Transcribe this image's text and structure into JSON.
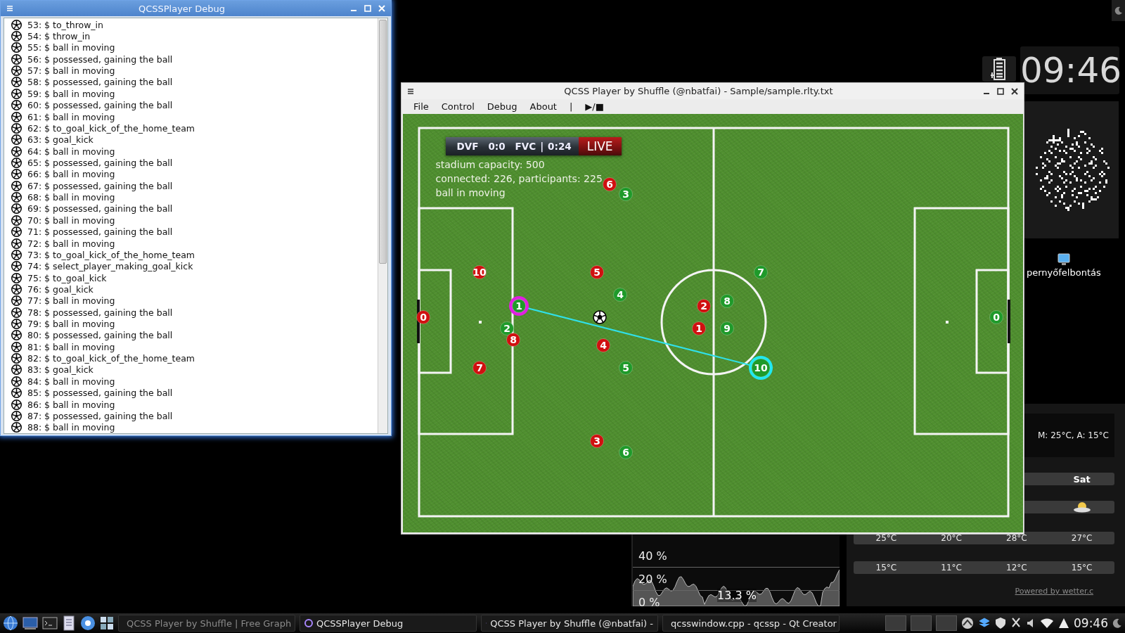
{
  "debug_window": {
    "title": "QCSSPlayer Debug",
    "log": [
      "53: $ to_throw_in",
      "54: $ throw_in",
      "55: $ ball in moving",
      "56: $ possessed, gaining the ball",
      "57: $ ball in moving",
      "58: $ possessed, gaining the ball",
      "59: $ ball in moving",
      "60: $ possessed, gaining the ball",
      "61: $ ball in moving",
      "62: $ to_goal_kick_of_the_home_team",
      "63: $ goal_kick",
      "64: $ ball in moving",
      "65: $ possessed, gaining the ball",
      "66: $ ball in moving",
      "67: $ possessed, gaining the ball",
      "68: $ ball in moving",
      "69: $ possessed, gaining the ball",
      "70: $ ball in moving",
      "71: $ possessed, gaining the ball",
      "72: $ ball in moving",
      "73: $ to_goal_kick_of_the_home_team",
      "74: $ select_player_making_goal_kick",
      "75: $ to_goal_kick",
      "76: $ goal_kick",
      "77: $ ball in moving",
      "78: $ possessed, gaining the ball",
      "79: $ ball in moving",
      "80: $ possessed, gaining the ball",
      "81: $ ball in moving",
      "82: $ to_goal_kick_of_the_home_team",
      "83: $ goal_kick",
      "84: $ ball in moving",
      "85: $ possessed, gaining the ball",
      "86: $ ball in moving",
      "87: $ possessed, gaining the ball",
      "88: $ ball in moving"
    ]
  },
  "player_window": {
    "title": "QCSS Player by Shuffle (@nbatfai) - Sample/sample.rlty.txt",
    "menu": [
      "File",
      "Control",
      "Debug",
      "About",
      "|",
      "▶/■"
    ],
    "scoreboard": {
      "home": "DVF",
      "score": "0:0",
      "away": "FVC",
      "separator": "|",
      "clock": "0:24",
      "live": "LIVE"
    },
    "stats": [
      "stadium capacity: 500",
      "connected: 226, participants: 225",
      "ball in moving"
    ],
    "players": [
      {
        "number": "6",
        "color": "#d01010",
        "kind": "plain"
      },
      {
        "number": "3",
        "color": "#1f9a2a",
        "kind": "plain"
      },
      {
        "number": "10",
        "color": "#d01010",
        "kind": "plain"
      },
      {
        "number": "5",
        "color": "#d01010",
        "kind": "plain"
      },
      {
        "number": "7",
        "color": "#1f9a2a",
        "kind": "plain"
      },
      {
        "number": "4",
        "color": "#1f9a2a",
        "kind": "plain"
      },
      {
        "number": "8",
        "color": "#1f9a2a",
        "kind": "plain"
      },
      {
        "number": "1",
        "color": "#1f9a2a",
        "kind": "passer"
      },
      {
        "number": "2",
        "color": "#d01010",
        "kind": "plain"
      },
      {
        "number": "0",
        "color": "#d01010",
        "kind": "plain"
      },
      {
        "number": "0",
        "color": "#1f9a2a",
        "kind": "plain"
      },
      {
        "number": "2",
        "color": "#1f9a2a",
        "kind": "plain"
      },
      {
        "number": "1",
        "color": "#d01010",
        "kind": "plain"
      },
      {
        "number": "9",
        "color": "#1f9a2a",
        "kind": "plain"
      },
      {
        "number": "8",
        "color": "#d01010",
        "kind": "plain"
      },
      {
        "number": "4",
        "color": "#d01010",
        "kind": "plain"
      },
      {
        "number": "7",
        "color": "#d01010",
        "kind": "plain"
      },
      {
        "number": "5",
        "color": "#1f9a2a",
        "kind": "plain"
      },
      {
        "number": "10",
        "color": "#1f9a2a",
        "kind": "receiver"
      },
      {
        "number": "3",
        "color": "#d01010",
        "kind": "plain"
      },
      {
        "number": "6",
        "color": "#1f9a2a",
        "kind": "plain"
      }
    ]
  },
  "desktop": {
    "clock": "09:46",
    "icon_label": "pernyőfelbontás"
  },
  "cpu_monitor": {
    "labels": [
      "40 %",
      "20 %",
      "0 %"
    ],
    "reading": "13.3 %"
  },
  "weather": {
    "summary": "M: 25°C, A: 15°C",
    "day": "Sat",
    "highs": [
      "25°C",
      "20°C",
      "28°C",
      "27°C"
    ],
    "lows": [
      "15°C",
      "11°C",
      "12°C",
      "15°C"
    ],
    "credit": "Powered by wetter.c"
  },
  "taskbar": {
    "tasks": [
      {
        "label": "QCSS Player by Shuffle | Free Graph",
        "disabled": true
      },
      {
        "label": "QCSSPlayer Debug",
        "disabled": false
      },
      {
        "label": "QCSS Player by Shuffle (@nbatfai) -",
        "disabled": false
      },
      {
        "label": "qcsswindow.cpp - qcssp - Qt Creator",
        "disabled": false
      }
    ],
    "clock": "09:46"
  }
}
